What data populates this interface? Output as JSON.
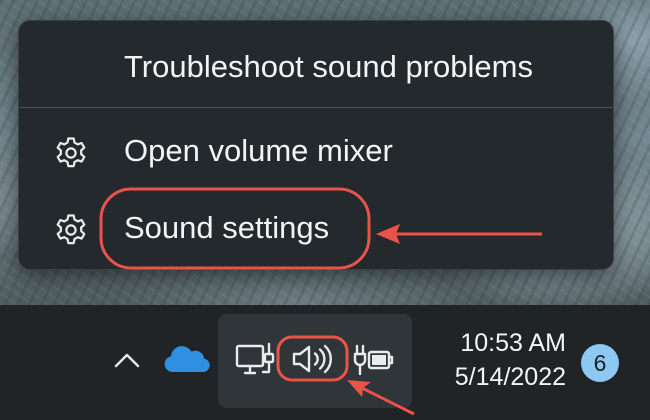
{
  "menu": {
    "items": [
      {
        "label": "Troubleshoot sound problems",
        "icon": null
      },
      {
        "label": "Open volume mixer",
        "icon": "gear-icon"
      },
      {
        "label": "Sound settings",
        "icon": "gear-icon"
      }
    ]
  },
  "taskbar": {
    "tray_icons": [
      "chevron-up-icon",
      "onedrive-cloud-icon",
      "network-ethernet-icon",
      "speaker-volume-icon",
      "battery-charging-icon"
    ],
    "clock": {
      "time": "10:53 AM",
      "date": "5/14/2022"
    },
    "notification_count": "6"
  },
  "annotations": {
    "highlight_color": "#e8534a",
    "targets": [
      "Sound settings",
      "speaker-volume-icon"
    ]
  },
  "colors": {
    "menu_background": "#23292d",
    "taskbar_background": "#202426",
    "onedrive_blue": "#2f8fe0",
    "badge_blue": "#8cc8f0"
  }
}
